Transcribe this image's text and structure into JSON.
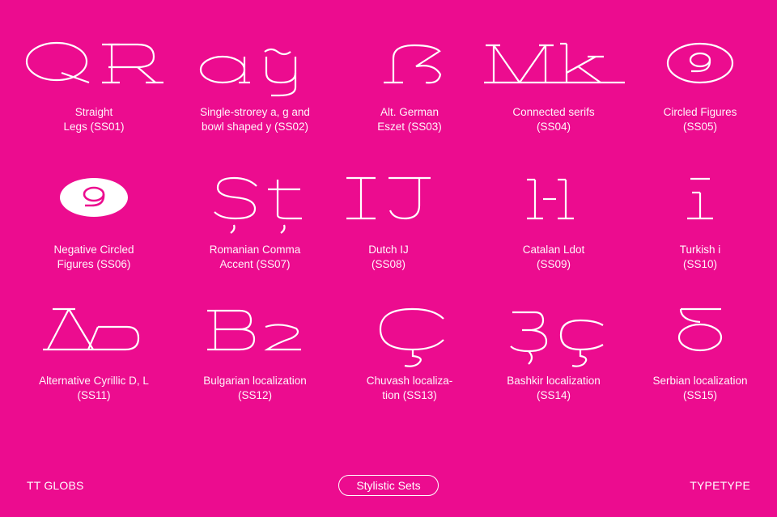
{
  "theme": {
    "background": "#EC0C8F",
    "foreground": "#FFFFFF"
  },
  "sets": [
    {
      "glyphs": "QR",
      "line1": "Straight",
      "line2": "Legs (SS01)"
    },
    {
      "glyphs": "aģy",
      "line1": "Single-strorey a, g and",
      "line2": "bowl shaped y (SS02)"
    },
    {
      "glyphs": "ẞ",
      "line1": "Alt. German",
      "line2": "Eszet (SS03)"
    },
    {
      "glyphs": "Mk",
      "line1": "Connected serifs",
      "line2": "(SS04)"
    },
    {
      "glyphs": "9",
      "line1": "Circled Figures",
      "line2": "(SS05)"
    },
    {
      "glyphs": "9",
      "line1": "Negative Circled",
      "line2": "Figures (SS06)"
    },
    {
      "glyphs": "Șț",
      "line1": "Romanian Comma",
      "line2": "Accent (SS07)"
    },
    {
      "glyphs": "IJ",
      "line1": "Dutch IJ",
      "line2": "(SS08)"
    },
    {
      "glyphs": "l·l",
      "line1": "Catalan Ldot",
      "line2": "(SS09)"
    },
    {
      "glyphs": "i",
      "line1": "Turkish i",
      "line2": "(SS10)"
    },
    {
      "glyphs": "Дл",
      "line1": "Alternative Cyrillic D, L",
      "line2": "(SS11)"
    },
    {
      "glyphs": "Вг",
      "line1": "Bulgarian localization",
      "line2": "(SS12)"
    },
    {
      "glyphs": "Ç",
      "line1": "Chuvash localiza-",
      "line2": "tion (SS13)"
    },
    {
      "glyphs": "Зç",
      "line1": "Bashkir localization",
      "line2": "(SS14)"
    },
    {
      "glyphs": "б",
      "line1": "Serbian localization",
      "line2": "(SS15)"
    }
  ],
  "footer": {
    "left": "TT GLOBS",
    "center": "Stylistic Sets",
    "right": "TYPETYPE"
  }
}
